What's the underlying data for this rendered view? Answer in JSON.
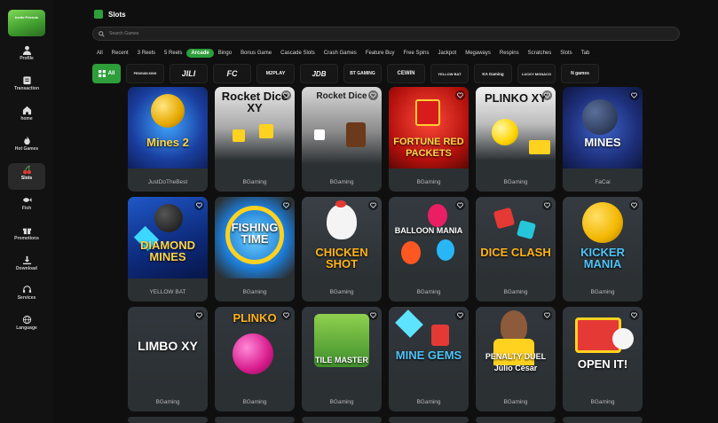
{
  "sidebar": {
    "invite_banner": "Invite Friends",
    "items": [
      {
        "label": "Profile",
        "icon": "person-icon"
      },
      {
        "label": "Transaction",
        "icon": "wallet-icon"
      },
      {
        "label": "home",
        "icon": "home-icon"
      },
      {
        "label": "Hot Games",
        "icon": "flame-icon"
      },
      {
        "label": "Slots",
        "icon": "cherry-icon"
      },
      {
        "label": "Fish",
        "icon": "fish-icon"
      },
      {
        "label": "Promotions",
        "icon": "gift-icon"
      },
      {
        "label": "Download",
        "icon": "download-icon"
      },
      {
        "label": "Services",
        "icon": "headset-icon"
      },
      {
        "label": "Language",
        "icon": "globe-icon"
      }
    ],
    "active": "Slots"
  },
  "header": {
    "title": "Slots"
  },
  "search": {
    "placeholder": "Search Games"
  },
  "categories": [
    "All",
    "Recent",
    "3 Reels",
    "5 Reels",
    "Arcade",
    "Bingo",
    "Bonus Game",
    "Cascade Slots",
    "Crash Games",
    "Feature Buy",
    "Free Spins",
    "Jackpot",
    "Megaways",
    "Respins",
    "Scratches",
    "Slots",
    "Tab"
  ],
  "active_category": "Arcade",
  "providers": [
    "All",
    "PENGUIN KING",
    "JILI",
    "FC",
    "M2PLAY",
    "JDB",
    "BT GAMING",
    "CEWIN",
    "YELLOW BAT",
    "KA Gaming",
    "LUCKY MONACO",
    "N games"
  ],
  "games": [
    {
      "title": "Mines 2",
      "provider": "JustDoTheBest"
    },
    {
      "title": "Rocket Dice XY",
      "provider": "BGaming"
    },
    {
      "title": "Rocket Dice",
      "provider": "BGaming"
    },
    {
      "title": "FORTUNE RED PACKETS",
      "provider": "BGaming"
    },
    {
      "title": "PLINKO XY",
      "provider": "BGaming"
    },
    {
      "title": "MINES",
      "provider": "FaCai"
    },
    {
      "title": "DIAMOND MINES",
      "provider": "YELLOW BAT"
    },
    {
      "title": "FISHING TIME",
      "provider": "BGaming"
    },
    {
      "title": "CHICKEN SHOT",
      "provider": "BGaming"
    },
    {
      "title": "BALLOON MANIA",
      "provider": "BGaming"
    },
    {
      "title": "DICE CLASH",
      "provider": "BGaming"
    },
    {
      "title": "KICKER MANIA",
      "provider": "BGaming"
    },
    {
      "title": "LIMBO XY",
      "provider": "BGaming"
    },
    {
      "title": "PLINKO",
      "provider": "BGaming"
    },
    {
      "title": "TILE MASTER",
      "provider": "BGaming"
    },
    {
      "title": "MINE GEMS",
      "provider": "BGaming"
    },
    {
      "title": "PENALTY DUEL Júlio César",
      "provider": "BGaming"
    },
    {
      "title": "OPEN IT!",
      "provider": "BGaming"
    }
  ],
  "colors": {
    "accent": "#2d9e3a",
    "background": "#0f0f0f",
    "card": "#2b3033"
  }
}
